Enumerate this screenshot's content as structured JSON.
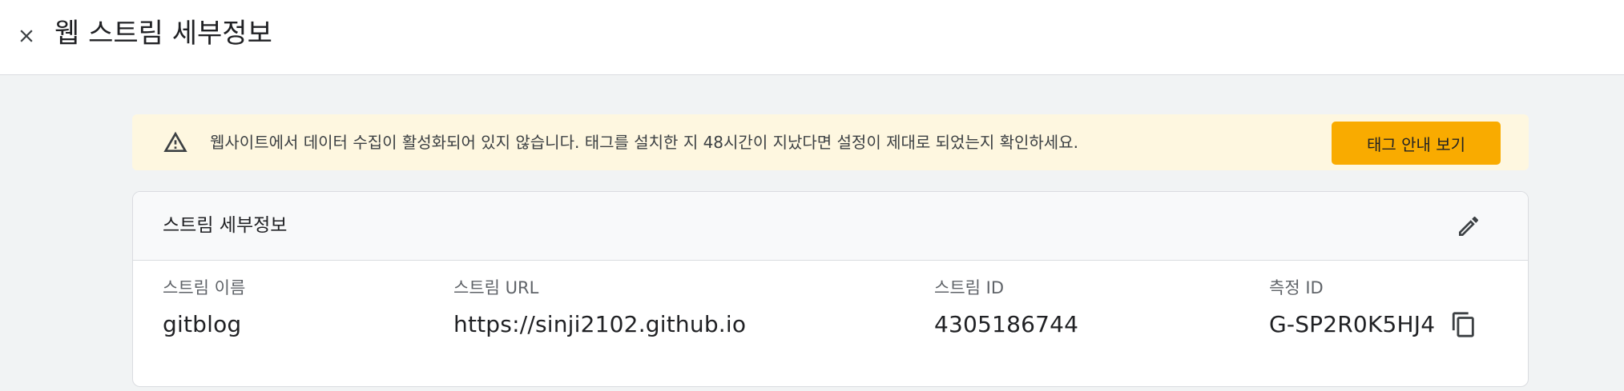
{
  "header": {
    "title": "웹 스트림 세부정보",
    "close_icon": "close-icon"
  },
  "banner": {
    "icon": "warning-icon",
    "message": "웹사이트에서 데이터 수집이 활성화되어 있지 않습니다. 태그를 설치한 지 48시간이 지났다면 설정이 제대로 되었는지 확인하세요.",
    "button_label": "태그 안내 보기",
    "colors": {
      "background": "#fef7e0",
      "button": "#f9ab00"
    }
  },
  "stream_card": {
    "title": "스트림 세부정보",
    "edit_icon": "pencil-icon",
    "fields": [
      {
        "label": "스트림 이름",
        "value": "gitblog"
      },
      {
        "label": "스트림 URL",
        "value": "https://sinji2102.github.io"
      },
      {
        "label": "스트림 ID",
        "value": "4305186744"
      },
      {
        "label": "측정 ID",
        "value": "G-SP2R0K5HJ4",
        "action_icon": "copy-icon"
      }
    ]
  }
}
